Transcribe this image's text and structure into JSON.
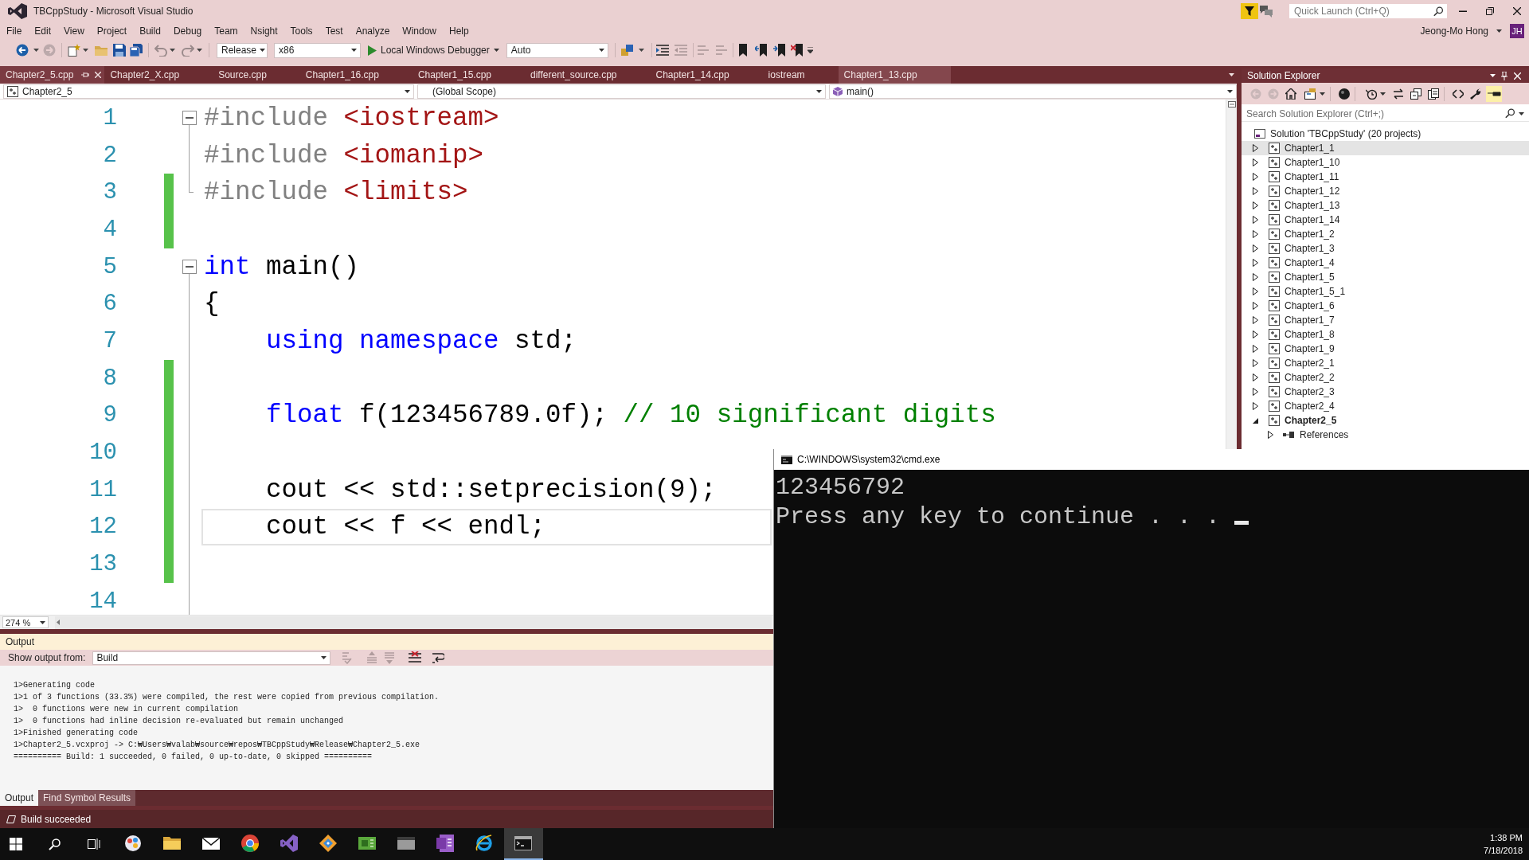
{
  "window": {
    "title": "TBCppStudy - Microsoft Visual Studio",
    "quick_launch": {
      "placeholder": "Quick Launch (Ctrl+Q)"
    },
    "user": {
      "name": "Jeong-Mo Hong",
      "initials": "JH"
    }
  },
  "menu": [
    "File",
    "Edit",
    "View",
    "Project",
    "Build",
    "Debug",
    "Team",
    "Nsight",
    "Tools",
    "Test",
    "Analyze",
    "Window",
    "Help"
  ],
  "toolbar": {
    "configuration": "Release",
    "platform": "x86",
    "debugger": "Local Windows Debugger",
    "debug_mode": "Auto"
  },
  "tabs": [
    {
      "label": "Chapter2_5.cpp",
      "selected": true,
      "hovered": false
    },
    {
      "label": "Chapter2_X.cpp",
      "selected": false,
      "hovered": false
    },
    {
      "label": "Source.cpp",
      "selected": false,
      "hovered": false
    },
    {
      "label": "Chapter1_16.cpp",
      "selected": false,
      "hovered": false
    },
    {
      "label": "Chapter1_15.cpp",
      "selected": false,
      "hovered": false
    },
    {
      "label": "different_source.cpp",
      "selected": false,
      "hovered": false
    },
    {
      "label": "Chapter1_14.cpp",
      "selected": false,
      "hovered": false
    },
    {
      "label": "iostream",
      "selected": false,
      "hovered": false
    },
    {
      "label": "Chapter1_13.cpp",
      "selected": false,
      "hovered": true
    }
  ],
  "navigation": {
    "project": "Chapter2_5",
    "scope": "(Global Scope)",
    "member": "main()"
  },
  "editor": {
    "lines": [
      {
        "number": "1",
        "changed": false,
        "current": false,
        "expanded": true,
        "tokens": [
          {
            "kind": "preprocessor",
            "text": "#include"
          },
          {
            "kind": "header",
            "text": " <iostream>"
          }
        ],
        "children": [
          {
            "number": "2",
            "changed": false,
            "current": false,
            "tokens": [
              {
                "kind": "preprocessor",
                "text": "#include"
              },
              {
                "kind": "header",
                "text": " <iomanip>"
              }
            ]
          },
          {
            "number": "3",
            "changed": true,
            "current": false,
            "tokens": [
              {
                "kind": "preprocessor",
                "text": "#include"
              },
              {
                "kind": "header",
                "text": " <limits>"
              }
            ]
          }
        ]
      },
      {
        "number": "4",
        "changed": true,
        "current": false
      },
      {
        "number": "5",
        "changed": false,
        "current": false,
        "expanded": true,
        "tokens": [
          {
            "kind": "keyword",
            "text": "int"
          },
          {
            "kind": "plain",
            "text": " main()"
          }
        ],
        "children": [
          {
            "number": "6",
            "changed": false,
            "current": false,
            "tokens": [
              {
                "kind": "plain",
                "text": "{"
              }
            ]
          },
          {
            "number": "7",
            "changed": false,
            "current": false,
            "tokens": [
              {
                "kind": "keyword",
                "text": "    using"
              },
              {
                "kind": "keyword",
                "text": " namespace"
              },
              {
                "kind": "plain",
                "text": " std;"
              }
            ]
          },
          {
            "number": "8",
            "changed": true,
            "current": false
          },
          {
            "number": "9",
            "changed": true,
            "current": false,
            "tokens": [
              {
                "kind": "keyword",
                "text": "    float"
              },
              {
                "kind": "plain",
                "text": " f(123456789.0f); "
              },
              {
                "kind": "comment",
                "text": "// 10 significant digits"
              }
            ]
          },
          {
            "number": "10",
            "changed": true,
            "current": false
          },
          {
            "number": "11",
            "changed": true,
            "current": false,
            "tokens": [
              {
                "kind": "plain",
                "text": "    cout << std::setprecision(9);"
              }
            ]
          },
          {
            "number": "12",
            "changed": true,
            "current": true,
            "tokens": [
              {
                "kind": "plain",
                "text": "    cout << f << endl;"
              }
            ]
          },
          {
            "number": "13",
            "changed": true,
            "current": false
          },
          {
            "number": "14",
            "changed": false,
            "current": false
          }
        ]
      }
    ],
    "zoom": "274 %"
  },
  "output": {
    "title": "Output",
    "source_label": "Show output from:",
    "source": "Build",
    "lines": [
      "1>Generating code",
      "1>1 of 3 functions (33.3%) were compiled, the rest were copied from previous compilation.",
      "1>  0 functions were new in current compilation",
      "1>  0 functions had inline decision re-evaluated but remain unchanged",
      "1>Finished generating code",
      "1>Chapter2_5.vcxproj -> C:₩Users₩valab₩source₩repos₩TBCppStudy₩Release₩Chapter2_5.exe",
      "========== Build: 1 succeeded, 0 failed, 0 up-to-date, 0 skipped =========="
    ],
    "tabs": [
      {
        "label": "Output",
        "selected": true
      },
      {
        "label": "Find Symbol Results",
        "selected": false
      }
    ]
  },
  "solution_explorer": {
    "title": "Solution Explorer",
    "toggle_button": {
      "on": true
    },
    "search": {
      "placeholder": "Search Solution Explorer (Ctrl+;)"
    },
    "solution": "Solution 'TBCppStudy' (20 projects)",
    "projects": [
      {
        "label": "Chapter1_1",
        "expanded": false,
        "selected": true,
        "startup": false
      },
      {
        "label": "Chapter1_10",
        "expanded": false,
        "selected": false,
        "startup": false
      },
      {
        "label": "Chapter1_11",
        "expanded": false,
        "selected": false,
        "startup": false
      },
      {
        "label": "Chapter1_12",
        "expanded": false,
        "selected": false,
        "startup": false
      },
      {
        "label": "Chapter1_13",
        "expanded": false,
        "selected": false,
        "startup": false
      },
      {
        "label": "Chapter1_14",
        "expanded": false,
        "selected": false,
        "startup": false
      },
      {
        "label": "Chapter1_2",
        "expanded": false,
        "selected": false,
        "startup": false
      },
      {
        "label": "Chapter1_3",
        "expanded": false,
        "selected": false,
        "startup": false
      },
      {
        "label": "Chapter1_4",
        "expanded": false,
        "selected": false,
        "startup": false
      },
      {
        "label": "Chapter1_5",
        "expanded": false,
        "selected": false,
        "startup": false
      },
      {
        "label": "Chapter1_5_1",
        "expanded": false,
        "selected": false,
        "startup": false
      },
      {
        "label": "Chapter1_6",
        "expanded": false,
        "selected": false,
        "startup": false
      },
      {
        "label": "Chapter1_7",
        "expanded": false,
        "selected": false,
        "startup": false
      },
      {
        "label": "Chapter1_8",
        "expanded": false,
        "selected": false,
        "startup": false
      },
      {
        "label": "Chapter1_9",
        "expanded": false,
        "selected": false,
        "startup": false
      },
      {
        "label": "Chapter2_1",
        "expanded": false,
        "selected": false,
        "startup": false
      },
      {
        "label": "Chapter2_2",
        "expanded": false,
        "selected": false,
        "startup": false
      },
      {
        "label": "Chapter2_3",
        "expanded": false,
        "selected": false,
        "startup": false
      },
      {
        "label": "Chapter2_4",
        "expanded": false,
        "selected": false,
        "startup": false
      },
      {
        "label": "Chapter2_5",
        "expanded": true,
        "selected": false,
        "startup": true,
        "children": [
          {
            "label": "References",
            "expanded": false,
            "selected": false
          }
        ]
      }
    ]
  },
  "status_bar": {
    "text": "Build succeeded"
  },
  "console": {
    "title": "C:\\WINDOWS\\system32\\cmd.exe",
    "lines": [
      "123456792",
      "Press any key to continue . . ."
    ]
  },
  "taskbar": {
    "apps": [
      {
        "selected": false
      },
      {
        "selected": false
      },
      {
        "selected": false
      },
      {
        "selected": false
      },
      {
        "selected": false
      },
      {
        "selected": false
      },
      {
        "selected": false
      },
      {
        "selected": false
      },
      {
        "selected": false
      },
      {
        "selected": false
      },
      {
        "selected": true
      }
    ],
    "time": "1:38 PM",
    "date": "7/18/2018"
  }
}
